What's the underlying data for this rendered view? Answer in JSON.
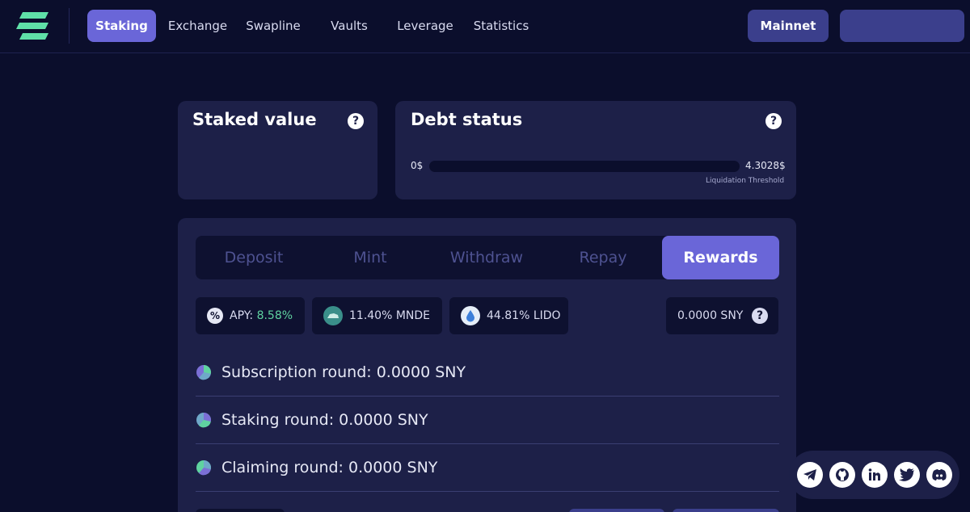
{
  "nav": {
    "items": [
      {
        "label": "Staking",
        "active": true
      },
      {
        "label": "Exchange",
        "active": false
      },
      {
        "label": "Swapline",
        "active": false
      },
      {
        "label": "Vaults",
        "active": false
      },
      {
        "label": "Leverage",
        "active": false
      },
      {
        "label": "Statistics",
        "active": false
      }
    ],
    "network_label": "Mainnet"
  },
  "staked": {
    "title": "Staked value",
    "help": "?"
  },
  "debt": {
    "title": "Debt status",
    "help": "?",
    "min_label": "0$",
    "max_label": "4.3028$",
    "threshold_label": "Liquidation Threshold",
    "fill_fraction": 0
  },
  "tabs": [
    {
      "label": "Deposit",
      "active": false
    },
    {
      "label": "Mint",
      "active": false
    },
    {
      "label": "Withdraw",
      "active": false
    },
    {
      "label": "Repay",
      "active": false
    },
    {
      "label": "Rewards",
      "active": true
    }
  ],
  "stats": {
    "apy_prefix": "APY:",
    "apy_value": "8.58%",
    "mnde": "11.40% MNDE",
    "lido": "44.81% LIDO",
    "sny_balance": "0.0000 SNY",
    "help": "?"
  },
  "rounds": [
    {
      "label": "Subscription round: 0.0000 SNY",
      "color": "#7b6fd6"
    },
    {
      "label": "Staking round: 0.0000 SNY",
      "color": "#6fa8c9"
    },
    {
      "label": "Claiming round: 0.0000 SNY",
      "color": "#5fd3a0"
    }
  ],
  "social": [
    "telegram-icon",
    "github-icon",
    "linkedin-icon",
    "twitter-icon",
    "discord-icon"
  ],
  "colors": {
    "accent": "#6a66d8",
    "background": "#0b0e2c",
    "card": "#1d2048",
    "positive": "#5fd3a0",
    "logo": "#5fe0a8"
  }
}
